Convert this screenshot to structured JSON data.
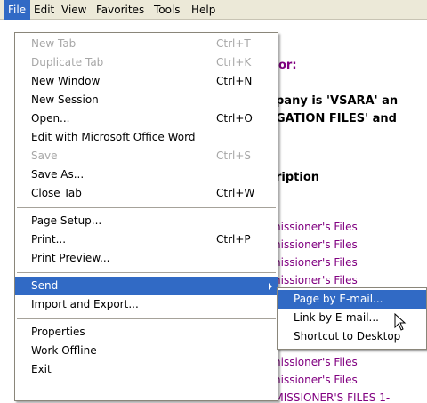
{
  "menubar": {
    "items": [
      "File",
      "Edit",
      "View",
      "Favorites",
      "Tools",
      "Help"
    ]
  },
  "page": {
    "heading_fragment": "or:",
    "line1": "pany is 'VSARA' an",
    "line2": "GATION FILES' and",
    "desc_header": "ription",
    "links": [
      "nissioner's Files",
      "nissioner's Files",
      "nissioner's Files",
      "nissioner's Files",
      "nissioner's Files",
      "nissioner's Files",
      "MMISSIONER'S FILES 1-"
    ]
  },
  "file_menu": {
    "items": [
      {
        "label": "New Tab",
        "shortcut": "Ctrl+T",
        "disabled": true
      },
      {
        "label": "Duplicate Tab",
        "shortcut": "Ctrl+K",
        "disabled": true
      },
      {
        "label": "New Window",
        "shortcut": "Ctrl+N"
      },
      {
        "label": "New Session",
        "shortcut": ""
      },
      {
        "label": "Open...",
        "shortcut": "Ctrl+O"
      },
      {
        "label": "Edit with Microsoft Office Word",
        "shortcut": ""
      },
      {
        "label": "Save",
        "shortcut": "Ctrl+S",
        "disabled": true
      },
      {
        "label": "Save As...",
        "shortcut": ""
      },
      {
        "label": "Close Tab",
        "shortcut": "Ctrl+W"
      },
      {
        "label": "Page Setup...",
        "shortcut": ""
      },
      {
        "label": "Print...",
        "shortcut": "Ctrl+P"
      },
      {
        "label": "Print Preview...",
        "shortcut": ""
      },
      {
        "label": "Send",
        "shortcut": "",
        "highlighted": true
      },
      {
        "label": "Import and Export...",
        "shortcut": ""
      },
      {
        "label": "Properties",
        "shortcut": ""
      },
      {
        "label": "Work Offline",
        "shortcut": ""
      },
      {
        "label": "Exit",
        "shortcut": ""
      }
    ]
  },
  "send_submenu": {
    "items": [
      {
        "label": "Page by E-mail...",
        "highlighted": true
      },
      {
        "label": "Link by E-mail..."
      },
      {
        "label": "Shortcut to Desktop"
      }
    ]
  },
  "colors": {
    "menu_highlight": "#316ac5",
    "menubar_bg": "#ece9d8",
    "link_color": "#800080"
  }
}
